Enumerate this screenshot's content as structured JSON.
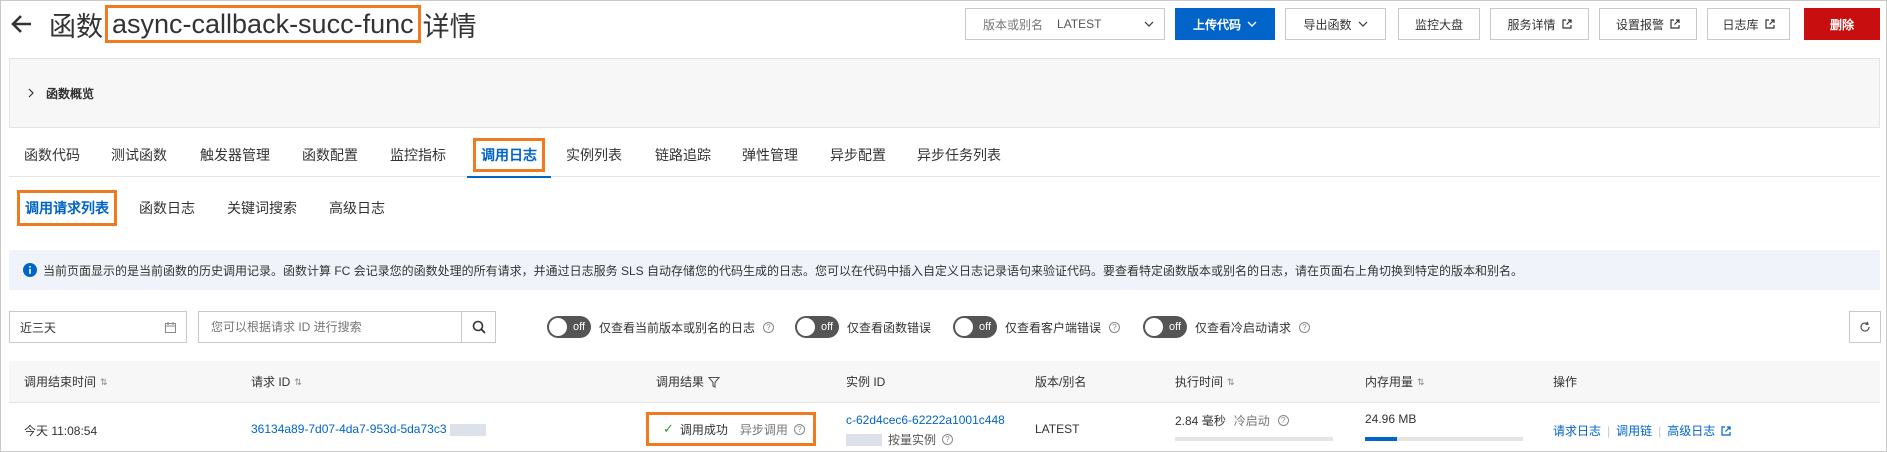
{
  "header": {
    "title_prefix": "函数",
    "function_name": "async-callback-succ-func",
    "title_suffix": "详情",
    "version_label": "版本或别名",
    "version_value": "LATEST",
    "buttons": {
      "upload": "上传代码",
      "export": "导出函数",
      "monitor": "监控大盘",
      "service": "服务详情",
      "alarm": "设置报警",
      "logstore": "日志库",
      "delete": "删除"
    }
  },
  "overview": {
    "label": "函数概览"
  },
  "tabs": [
    {
      "label": "函数代码"
    },
    {
      "label": "测试函数"
    },
    {
      "label": "触发器管理"
    },
    {
      "label": "函数配置"
    },
    {
      "label": "监控指标"
    },
    {
      "label": "调用日志"
    },
    {
      "label": "实例列表"
    },
    {
      "label": "链路追踪"
    },
    {
      "label": "弹性管理"
    },
    {
      "label": "异步配置"
    },
    {
      "label": "异步任务列表"
    }
  ],
  "subtabs": [
    {
      "label": "调用请求列表"
    },
    {
      "label": "函数日志"
    },
    {
      "label": "关键词搜索"
    },
    {
      "label": "高级日志"
    }
  ],
  "info": {
    "text": "当前页面显示的是当前函数的历史调用记录。函数计算 FC 会记录您的函数处理的所有请求，并通过日志服务 SLS 自动存储您的代码生成的日志。您可以在代码中插入自定义日志记录语句来验证代码。要查看特定函数版本或别名的日志，请在页面右上角切换到特定的版本和别名。"
  },
  "filters": {
    "date_range": "近三天",
    "search_placeholder": "您可以根据请求 ID 进行搜索",
    "toggles": [
      {
        "state": "off",
        "label": "仅查看当前版本或别名的日志",
        "help": true
      },
      {
        "state": "off",
        "label": "仅查看函数错误",
        "help": false
      },
      {
        "state": "off",
        "label": "仅查看客户端错误",
        "help": true
      },
      {
        "state": "off",
        "label": "仅查看冷启动请求",
        "help": true
      }
    ]
  },
  "table": {
    "columns": {
      "end_time": "调用结束时间",
      "request_id": "请求 ID",
      "result": "调用结果",
      "instance_id": "实例 ID",
      "version": "版本/别名",
      "duration": "执行时间",
      "memory": "内存用量",
      "actions": "操作"
    },
    "rows": [
      {
        "end_time": "今天 11:08:54",
        "request_id": "36134a89-7d07-4da7-953d-5da73c3",
        "result": "调用成功",
        "invoke_type": "异步调用",
        "instance_id": "c-62d4cec6-62222a1001c448",
        "instance_mode": "按量实例",
        "version": "LATEST",
        "duration": "2.84 毫秒",
        "cold_start": "冷启动",
        "duration_fraction": 0.0,
        "memory": "24.96 MB",
        "memory_fraction": 0.2,
        "actions": {
          "request_log": "请求日志",
          "trace": "调用链",
          "advanced_log": "高级日志"
        }
      }
    ]
  }
}
